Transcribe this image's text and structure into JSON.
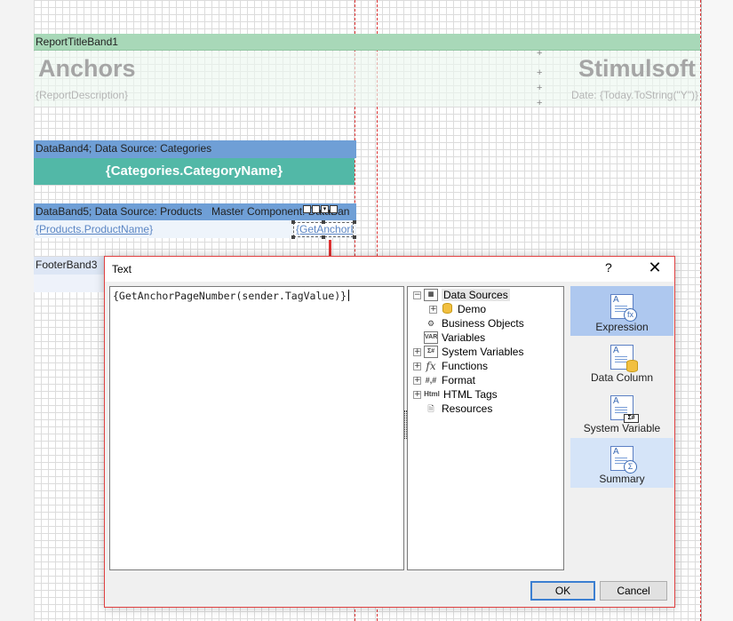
{
  "designer": {
    "report_title_band": "ReportTitleBand1",
    "title_left": "Anchors",
    "title_right": "Stimulsoft",
    "report_description": "{ReportDescription}",
    "date_expression": "Date: {Today.ToString(\"Y\")}",
    "databand4_header": "DataBand4; Data Source: Categories",
    "category_name": "{Categories.CategoryName}",
    "databand5_header": "DataBand5; Data Source: Products",
    "master_component": "Master Component: DataBan",
    "product_name": "{Products.ProductName}",
    "anchor_text": "{GetAnchorP",
    "footer_band": "FooterBand3"
  },
  "dialog": {
    "title": "Text",
    "help": "?",
    "close": "✕",
    "expression": "{GetAnchorPageNumber(sender.TagValue)}",
    "tree": [
      {
        "label": "Data Sources",
        "expander": "−",
        "icon": "table-icon"
      },
      {
        "label": "Demo",
        "expander": "+",
        "icon": "database-icon"
      },
      {
        "label": "Business Objects",
        "expander": "",
        "icon": "business-objects-icon"
      },
      {
        "label": "Variables",
        "expander": "",
        "icon": "variables-icon",
        "glyph": "VAR"
      },
      {
        "label": "System Variables",
        "expander": "+",
        "icon": "system-variables-icon",
        "glyph": "Σ#"
      },
      {
        "label": "Functions",
        "expander": "+",
        "icon": "functions-icon",
        "glyph": "fx"
      },
      {
        "label": "Format",
        "expander": "+",
        "icon": "format-icon",
        "glyph": "#,#"
      },
      {
        "label": "HTML Tags",
        "expander": "+",
        "icon": "html-icon",
        "glyph": "Html"
      },
      {
        "label": "Resources",
        "expander": "",
        "icon": "resources-icon"
      }
    ],
    "side_buttons": [
      {
        "label": "Expression",
        "icon": "expression-icon",
        "badge": "fx"
      },
      {
        "label": "Data Column",
        "icon": "data-column-icon"
      },
      {
        "label": "System Variable",
        "icon": "system-variable-icon",
        "badge": "Σ#"
      },
      {
        "label": "Summary",
        "icon": "summary-icon",
        "badge": "Σ"
      }
    ],
    "ok": "OK",
    "cancel": "Cancel"
  }
}
